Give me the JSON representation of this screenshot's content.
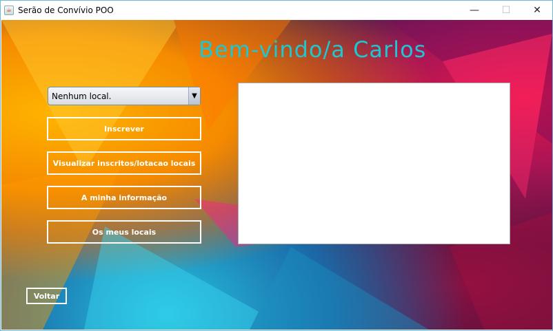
{
  "window": {
    "title": "Serão de Convívio POO",
    "minimize": "—",
    "maximize": "☐",
    "close": "✕"
  },
  "main": {
    "welcome": "Bem-vindo/a Carlos",
    "local_select": {
      "value": "Nenhum local.",
      "arrow": "▼"
    },
    "buttons": {
      "inscrever": "Inscrever",
      "visualizar": "Visualizar inscritos/lotacao locais",
      "info": "A minha informação",
      "locais": "Os meus locais",
      "voltar": "Voltar"
    }
  }
}
